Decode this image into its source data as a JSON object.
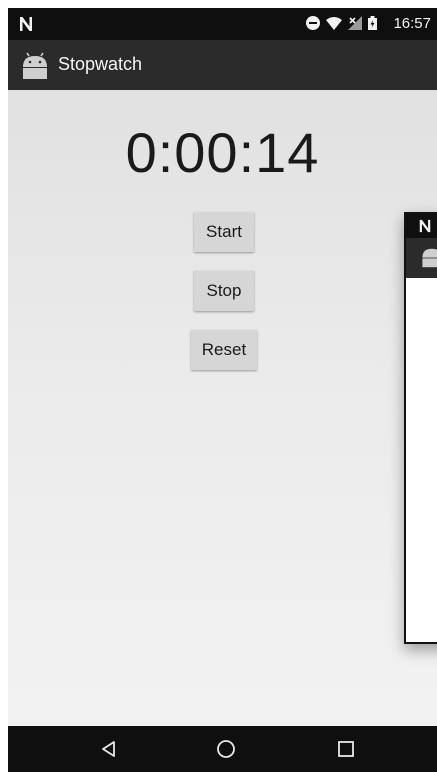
{
  "status_bar": {
    "time": "16:57",
    "icons": [
      "n-logo-icon",
      "do-not-disturb-icon",
      "wifi-icon",
      "no-signal-icon",
      "battery-icon"
    ]
  },
  "app_bar": {
    "title": "Stopwatch",
    "icon": "android-icon"
  },
  "stopwatch": {
    "time": "0:00:14",
    "start_label": "Start",
    "stop_label": "Stop",
    "reset_label": "Reset"
  },
  "nav_bar": {
    "icons": [
      "back-icon",
      "home-icon",
      "recents-icon"
    ]
  },
  "colors": {
    "status_bar": "#0f0f0f",
    "app_bar": "#2b2b2b",
    "content_background": "#e6e6e6",
    "button": "#d6d6d6",
    "text": "#1a1a1a"
  }
}
